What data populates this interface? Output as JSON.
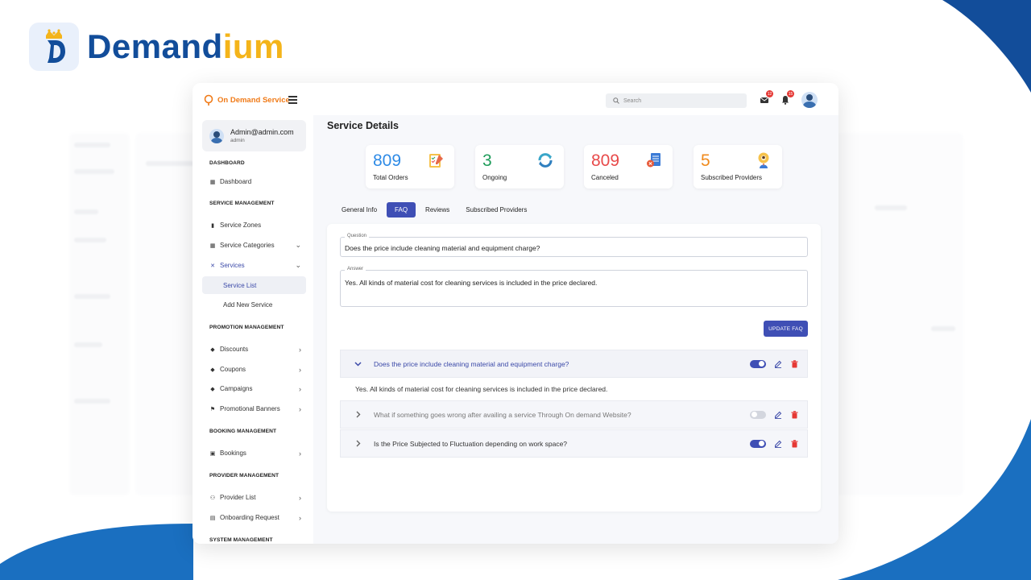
{
  "brand": {
    "part1": "Demand",
    "part2": "ium"
  },
  "colors": {
    "brand_blue": "#124d9a",
    "brand_yellow": "#f4b41a",
    "accent": "#3f4fb5",
    "logo_orange": "#f07a17"
  },
  "app": {
    "name": "On Demand Service"
  },
  "search": {
    "placeholder": "Search"
  },
  "notifications": {
    "mail_count": "12",
    "bell_count": "15"
  },
  "user": {
    "email": "Admin@admin.com",
    "role": "admin"
  },
  "sidebar": {
    "sections": {
      "dashboard": "DASHBOARD",
      "service_management": "SERVICE MANAGEMENT",
      "promotion_management": "PROMOTION MANAGEMENT",
      "booking_management": "BOOKING MANAGEMENT",
      "provider_management": "PROVIDER MANAGEMENT",
      "system_management": "SYSTEM MANAGEMENT"
    },
    "items": {
      "dashboard": "Dashboard",
      "service_zones": "Service Zones",
      "service_categories": "Service Categories",
      "services": "Services",
      "service_list": "Service List",
      "add_new_service": "Add New Service",
      "discounts": "Discounts",
      "coupons": "Coupons",
      "campaigns": "Campaigns",
      "promotional_banners": "Promotional Banners",
      "bookings": "Bookings",
      "provider_list": "Provider List",
      "onboarding_request": "Onboarding Request"
    }
  },
  "page": {
    "title": "Service Details"
  },
  "stats": [
    {
      "value": "809",
      "label": "Total Orders",
      "color": "#2f8be6",
      "icon": "clipboard-checklist-icon"
    },
    {
      "value": "3",
      "label": "Ongoing",
      "color": "#1e9c5a",
      "icon": "refresh-icon"
    },
    {
      "value": "809",
      "label": "Canceled",
      "color": "#e84a4a",
      "icon": "document-cancel-icon"
    },
    {
      "value": "5",
      "label": "Subscribed Providers",
      "color": "#f08a1c",
      "icon": "provider-badge-icon"
    }
  ],
  "tabs": [
    "General Info",
    "FAQ",
    "Reviews",
    "Subscribed Providers"
  ],
  "active_tab": "FAQ",
  "faq_form": {
    "question_label": "Question",
    "question_value": "Does the price include cleaning material and equipment charge?",
    "answer_label": "Answer",
    "answer_value": "Yes. All kinds of material cost for cleaning services is included in the price declared.",
    "submit_label": "UPDATE FAQ"
  },
  "faqs": [
    {
      "question": "Does the price include cleaning material and equipment charge?",
      "answer": "Yes. All kinds of material cost for cleaning services is included in the price declared.",
      "expanded": true,
      "active": true
    },
    {
      "question": "What if something goes wrong after availing a service Through On demand Website?",
      "expanded": false,
      "active": false
    },
    {
      "question": "Is the Price Subjected to Fluctuation depending on work space?",
      "expanded": false,
      "active": true
    }
  ]
}
